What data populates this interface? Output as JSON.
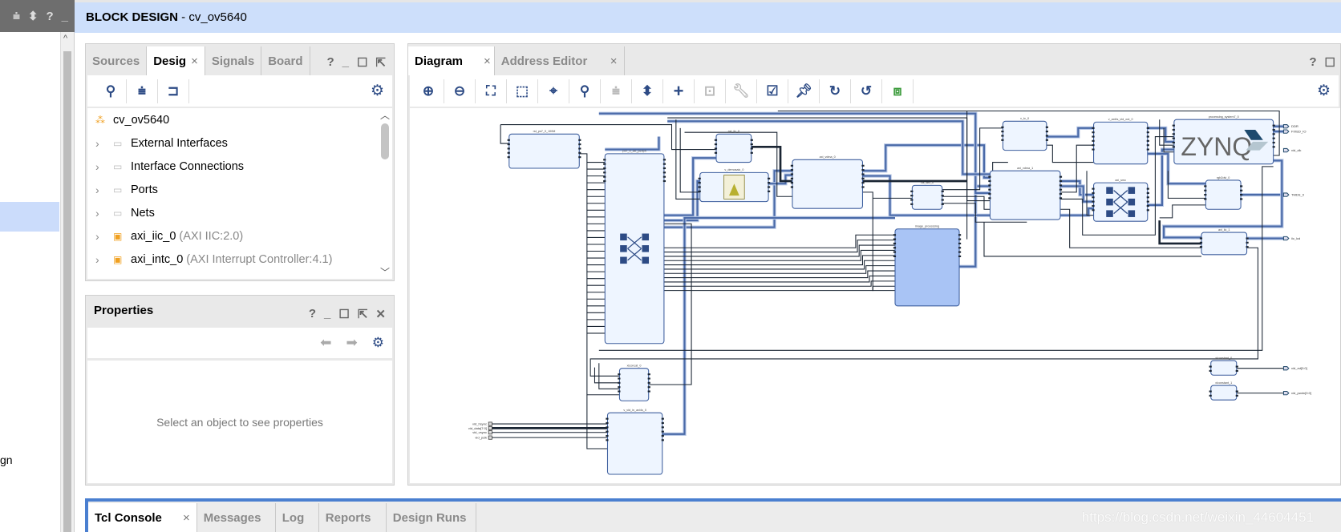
{
  "left_strip": {
    "icons": [
      "collapse-all-icon",
      "expand-icon",
      "help-icon",
      "minimize-icon"
    ],
    "partial_text": "gn"
  },
  "header": {
    "title": "BLOCK DESIGN",
    "subtitle": " - cv_ov5640"
  },
  "sources_panel": {
    "tabs": [
      {
        "label": "Sources"
      },
      {
        "label": "Desig",
        "active": true
      },
      {
        "label": "Signals"
      },
      {
        "label": "Board"
      }
    ],
    "window_buttons": [
      "?",
      "_",
      "□",
      "⇱"
    ],
    "tree": [
      {
        "label": "cv_ov5640",
        "type": "root"
      },
      {
        "label": "External Interfaces",
        "type": "folder"
      },
      {
        "label": "Interface Connections",
        "type": "folder"
      },
      {
        "label": "Ports",
        "type": "folder"
      },
      {
        "label": "Nets",
        "type": "folder"
      },
      {
        "label": "axi_iic_0",
        "detail": "(AXI IIC:2.0)",
        "type": "ip"
      },
      {
        "label": "axi_intc_0",
        "detail": "(AXI Interrupt Controller:4.1)",
        "type": "ip"
      }
    ]
  },
  "properties_panel": {
    "title": "Properties",
    "empty_message": "Select an object to see properties"
  },
  "diagram_panel": {
    "tabs": [
      {
        "label": "Diagram",
        "active": true
      },
      {
        "label": "Address Editor"
      }
    ],
    "toolbar": [
      "zoom-in",
      "zoom-out",
      "fit-view",
      "zoom-area",
      "center",
      "search",
      "collapse-all",
      "expand-all",
      "add-ip",
      "route-disabled",
      "tools",
      "validate",
      "pin",
      "refresh",
      "regenerate-layout",
      "optimize-routing"
    ],
    "blocks": {
      "rst": "rst_ps7_0_100M",
      "periph": "ps7_0_axi_periph",
      "iic0": "axi_iic_0",
      "demosaic": "v_demosaic_0",
      "vdma0": "axi_vdma_0",
      "clkwiz": "clk_wiz_0",
      "imgproc": "image_processing",
      "vtc": "v_tc_0",
      "vidout": "v_axi4s_vid_out_0",
      "vdma1": "axi_vdma_1",
      "smc": "axi_smc",
      "ps7": "processing_system7_0",
      "zynq_logo": "ZYNQ",
      "rgb2dvi": "rgb2dvi_0",
      "iic1": "axi_iic_1",
      "concat": "xlconcat_0",
      "vidin": "v_vid_in_axi4s_0",
      "const0": "xlconstant_0",
      "const1": "xlconstant_1"
    },
    "ports": {
      "ddr": "DDR",
      "fixed_io": "FIXED_IO",
      "vid_clk": "vid_clk",
      "tmds": "TMDS_0",
      "iic": "iic_lcd",
      "rst": "vid_rst[0:0]",
      "pwdn": "vid_pwdn[0:0]",
      "hsync": "vid_hsync",
      "data": "vid_data[7:0]",
      "vsync": "vid_vsync",
      "pclk": "vid_pclk"
    },
    "colors": {
      "block_fill": "#eef5ff",
      "block_border": "#3e5f9e",
      "selected_fill": "#a9c4f5",
      "bus": "#4a6aa8",
      "net": "#1a2533"
    }
  },
  "console": {
    "tabs": [
      {
        "label": "Tcl Console",
        "active": true
      },
      {
        "label": "Messages"
      },
      {
        "label": "Log"
      },
      {
        "label": "Reports"
      },
      {
        "label": "Design Runs"
      }
    ],
    "watermark": "https://blog.csdn.net/weixin_44604451"
  }
}
